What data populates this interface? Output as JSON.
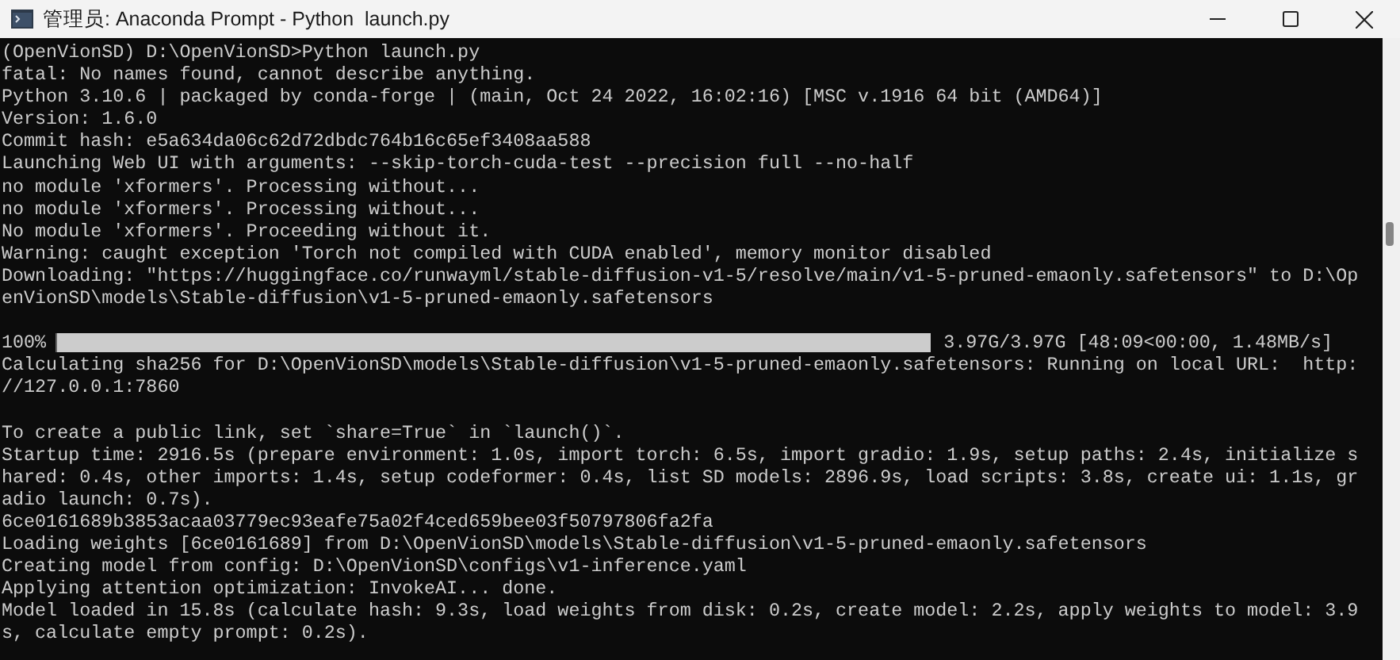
{
  "window": {
    "title": "管理员: Anaconda Prompt - Python  launch.py"
  },
  "console": {
    "lines": [
      {
        "kind": "text",
        "text": "(OpenVionSD) D:\\OpenVionSD>Python launch.py"
      },
      {
        "kind": "text",
        "text": "fatal: No names found, cannot describe anything."
      },
      {
        "kind": "text",
        "text": "Python 3.10.6 | packaged by conda-forge | (main, Oct 24 2022, 16:02:16) [MSC v.1916 64 bit (AMD64)]"
      },
      {
        "kind": "text",
        "text": "Version: 1.6.0"
      },
      {
        "kind": "text",
        "text": "Commit hash: e5a634da06c62d72dbdc764b16c65ef3408aa588"
      },
      {
        "kind": "text",
        "text": "Launching Web UI with arguments: --skip-torch-cuda-test --precision full --no-half"
      },
      {
        "kind": "text",
        "text": "no module 'xformers'. Processing without..."
      },
      {
        "kind": "text",
        "text": "no module 'xformers'. Processing without..."
      },
      {
        "kind": "text",
        "text": "No module 'xformers'. Proceeding without it."
      },
      {
        "kind": "text",
        "text": "Warning: caught exception 'Torch not compiled with CUDA enabled', memory monitor disabled"
      },
      {
        "kind": "text",
        "text": "Downloading: \"https://huggingface.co/runwayml/stable-diffusion-v1-5/resolve/main/v1-5-pruned-emaonly.safetensors\" to D:\\Op"
      },
      {
        "kind": "text",
        "text": "enVionSD\\models\\Stable-diffusion\\v1-5-pruned-emaonly.safetensors"
      },
      {
        "kind": "blank"
      },
      {
        "kind": "progress",
        "percent": "100%",
        "level": 1,
        "reading": "3.97G/3.97G [48:09<00:00, 1.48MB/s]"
      },
      {
        "kind": "text",
        "text": "Calculating sha256 for D:\\OpenVionSD\\models\\Stable-diffusion\\v1-5-pruned-emaonly.safetensors: Running on local URL:  http:"
      },
      {
        "kind": "text",
        "text": "//127.0.0.1:7860"
      },
      {
        "kind": "blank"
      },
      {
        "kind": "text",
        "text": "To create a public link, set `share=True` in `launch()`."
      },
      {
        "kind": "text",
        "text": "Startup time: 2916.5s (prepare environment: 1.0s, import torch: 6.5s, import gradio: 1.9s, setup paths: 2.4s, initialize s"
      },
      {
        "kind": "text",
        "text": "hared: 0.4s, other imports: 1.4s, setup codeformer: 0.4s, list SD models: 2896.9s, load scripts: 3.8s, create ui: 1.1s, gr"
      },
      {
        "kind": "text",
        "text": "adio launch: 0.7s)."
      },
      {
        "kind": "text",
        "text": "6ce0161689b3853acaa03779ec93eafe75a02f4ced659bee03f50797806fa2fa"
      },
      {
        "kind": "text",
        "text": "Loading weights [6ce0161689] from D:\\OpenVionSD\\models\\Stable-diffusion\\v1-5-pruned-emaonly.safetensors"
      },
      {
        "kind": "text",
        "text": "Creating model from config: D:\\OpenVionSD\\configs\\v1-inference.yaml"
      },
      {
        "kind": "text",
        "text": "Applying attention optimization: InvokeAI... done."
      },
      {
        "kind": "text",
        "text": "Model loaded in 15.8s (calculate hash: 9.3s, load weights from disk: 0.2s, create model: 2.2s, apply weights to model: 3.9"
      },
      {
        "kind": "text",
        "text": "s, calculate empty prompt: 0.2s)."
      }
    ]
  }
}
